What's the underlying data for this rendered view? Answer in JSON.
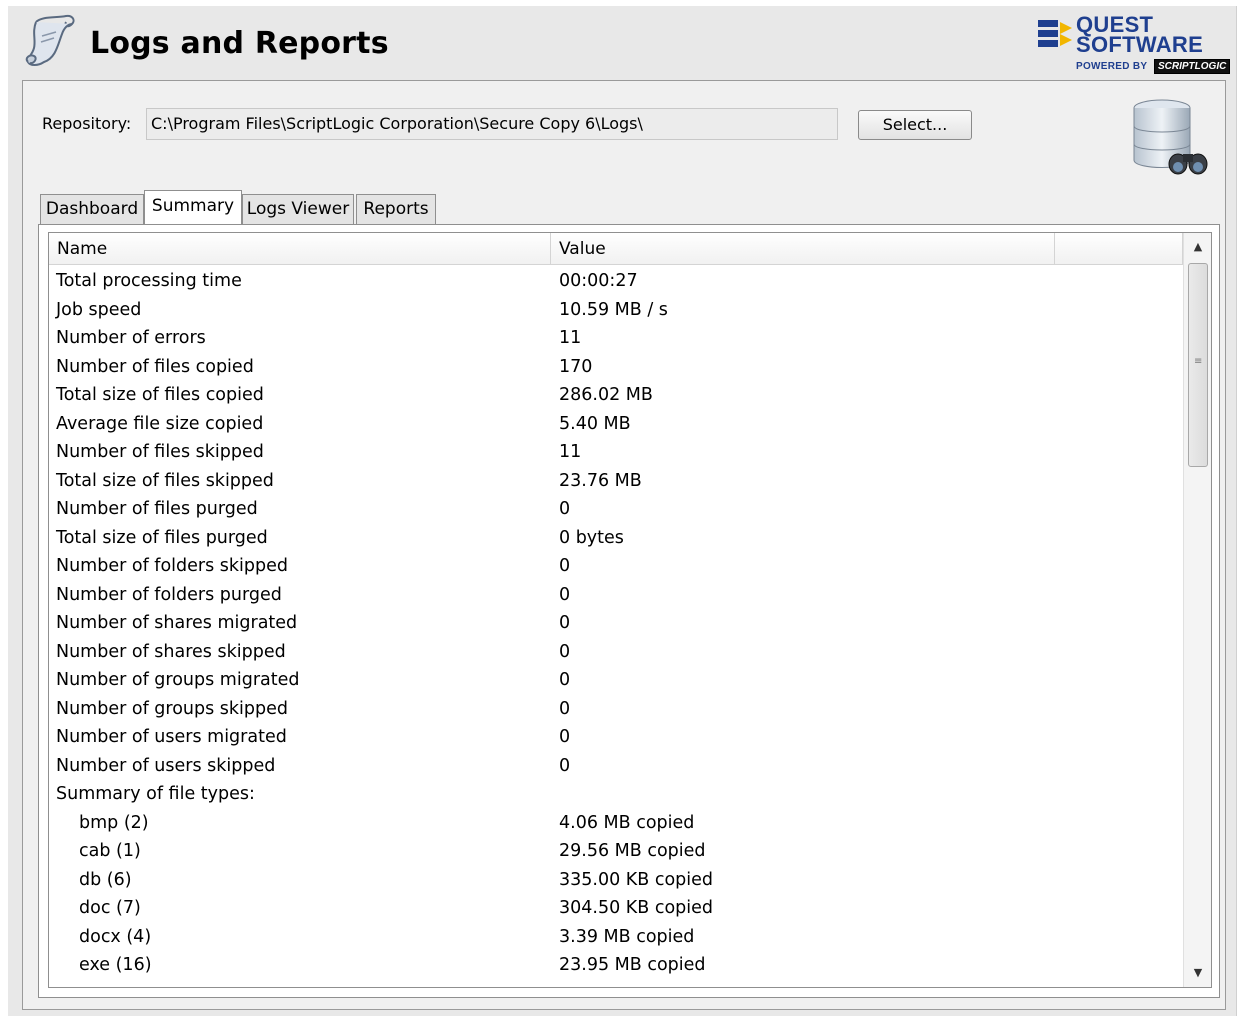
{
  "header": {
    "title": "Logs and Reports",
    "brand_line1": "QUEST",
    "brand_line2": "SOFTWARE",
    "powered_by": "POWERED BY",
    "powered_brand": "SCRIPTLOGIC",
    "brand_color": "#1f3f8f"
  },
  "repository": {
    "label": "Repository:",
    "path": "C:\\Program Files\\ScriptLogic Corporation\\Secure Copy 6\\Logs\\",
    "select_label": "Select..."
  },
  "tabs": [
    {
      "label": "Dashboard",
      "active": false
    },
    {
      "label": "Summary",
      "active": true
    },
    {
      "label": "Logs Viewer",
      "active": false
    },
    {
      "label": "Reports",
      "active": false
    }
  ],
  "grid": {
    "columns": [
      "Name",
      "Value"
    ],
    "rows": [
      {
        "name": "Total processing time",
        "value": "00:00:27"
      },
      {
        "name": "Job speed",
        "value": "10.59 MB / s"
      },
      {
        "name": "Number of errors",
        "value": "11"
      },
      {
        "name": "Number of files copied",
        "value": "170"
      },
      {
        "name": "Total size of files copied",
        "value": "286.02 MB"
      },
      {
        "name": "Average file size copied",
        "value": "5.40 MB"
      },
      {
        "name": "Number of files skipped",
        "value": "11"
      },
      {
        "name": "Total size of files skipped",
        "value": "23.76 MB"
      },
      {
        "name": "Number of files purged",
        "value": "0"
      },
      {
        "name": "Total size of files purged",
        "value": "0 bytes"
      },
      {
        "name": "Number of folders skipped",
        "value": "0"
      },
      {
        "name": "Number of folders purged",
        "value": "0"
      },
      {
        "name": "Number of shares migrated",
        "value": "0"
      },
      {
        "name": "Number of shares skipped",
        "value": "0"
      },
      {
        "name": "Number of groups migrated",
        "value": "0"
      },
      {
        "name": "Number of groups skipped",
        "value": "0"
      },
      {
        "name": "Number of users migrated",
        "value": "0"
      },
      {
        "name": "Number of users skipped",
        "value": "0"
      },
      {
        "name": "Summary of file types:",
        "value": ""
      },
      {
        "name": "bmp (2)",
        "value": "4.06 MB copied",
        "sub": true
      },
      {
        "name": "cab (1)",
        "value": "29.56 MB copied",
        "sub": true
      },
      {
        "name": "db (6)",
        "value": "335.00 KB copied",
        "sub": true
      },
      {
        "name": "doc (7)",
        "value": "304.50 KB copied",
        "sub": true
      },
      {
        "name": "docx (4)",
        "value": "3.39 MB copied",
        "sub": true
      },
      {
        "name": "exe (16)",
        "value": "23.95 MB copied",
        "sub": true
      }
    ]
  }
}
